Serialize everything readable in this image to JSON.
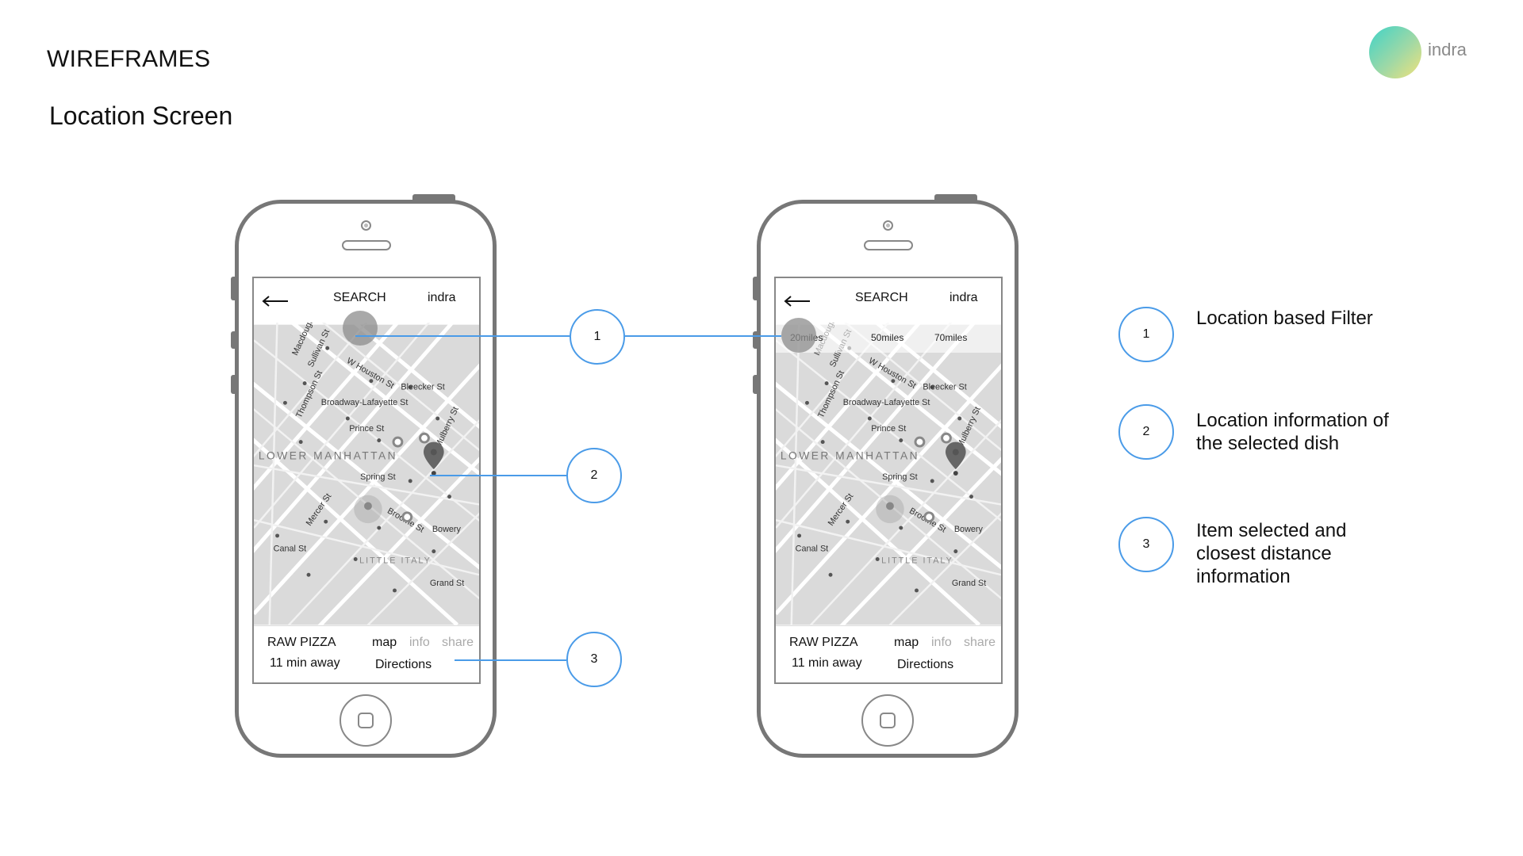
{
  "header": {
    "title": "WIREFRAMES",
    "subtitle": "Location Screen"
  },
  "logo": {
    "text": "indra",
    "gradient": [
      "#3fd3c8",
      "#f2e27a"
    ]
  },
  "accent_color": "#4a9be8",
  "phone": {
    "topbar": {
      "back_icon": "arrow-left-icon",
      "search_label": "SEARCH",
      "brand_label": "indra"
    },
    "bottom": {
      "title": "RAW PIZZA",
      "subtitle": "11 min away",
      "tab_map": "map",
      "tab_info": "info",
      "tab_share": "share",
      "directions": "Directions"
    },
    "filters": [
      "20miles",
      "50miles",
      "70miles"
    ]
  },
  "map_labels": {
    "lower_manhattan": "LOWER MANHATTAN",
    "little_italy": "LITTLE ITALY",
    "spring_st": "Spring St",
    "prince_st": "Prince St",
    "canal_st": "Canal St",
    "bleecker_st": "Bleecker St",
    "broadway_lafayette": "Broadway-Lafayette St",
    "bowery": "Bowery",
    "grand_st": "Grand St",
    "houston": "W Houston St",
    "mulberry": "Mulberry St",
    "mercer": "Mercer St",
    "broome": "Broome St",
    "thompson": "Thompson St",
    "sullivan": "Sullivan St",
    "macdougal": "Macdougal"
  },
  "callouts": [
    "1",
    "2",
    "3"
  ],
  "legend": [
    {
      "number": "1",
      "text": "Location based Filter"
    },
    {
      "number": "2",
      "line1": "Location information of",
      "line2": "the selected dish"
    },
    {
      "number": "3",
      "line1": "Item selected and",
      "line2": "closest distance",
      "line3": "information"
    }
  ]
}
